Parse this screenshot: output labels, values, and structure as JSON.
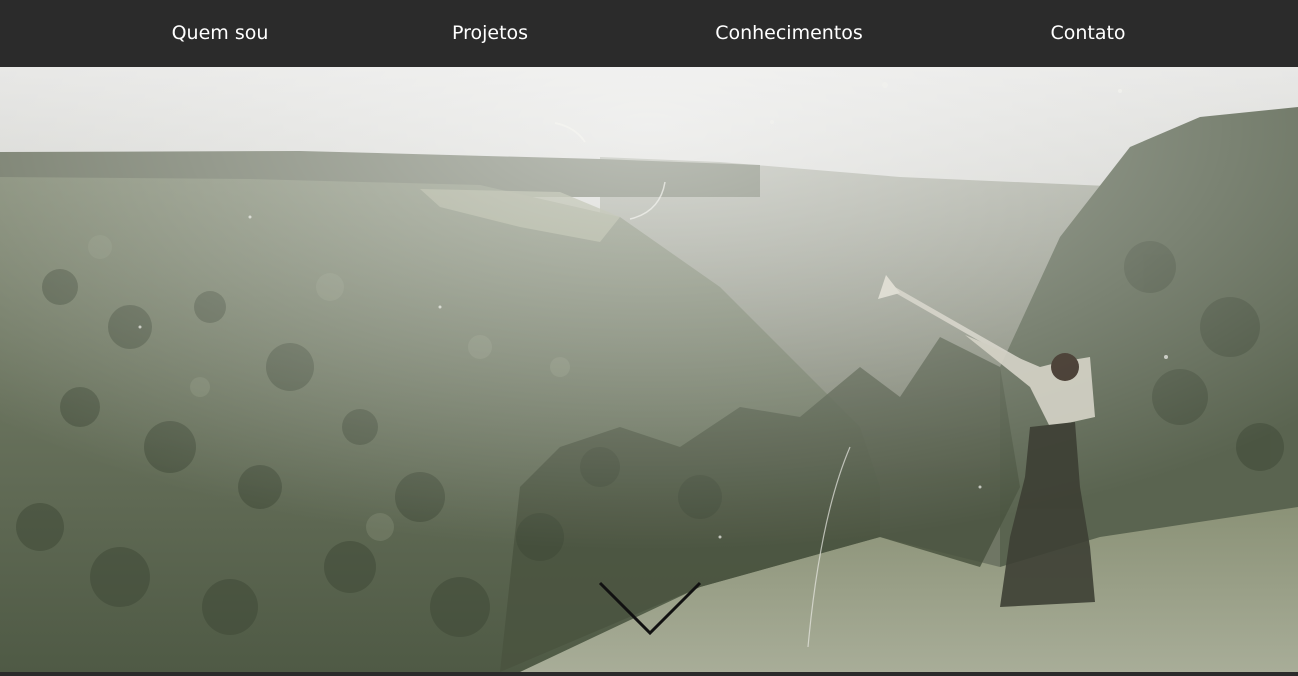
{
  "nav": {
    "items": [
      {
        "label": "Quem sou"
      },
      {
        "label": "Projetos"
      },
      {
        "label": "Conhecimentos"
      },
      {
        "label": "Contato"
      }
    ]
  },
  "hero": {
    "image": "misty-forest-valley-woman-horn-photo",
    "scroll_icon": "chevron-down-icon"
  },
  "colors": {
    "navbar": "#2b2b2b",
    "nav_text": "#ffffff",
    "arrow": "#111111"
  }
}
